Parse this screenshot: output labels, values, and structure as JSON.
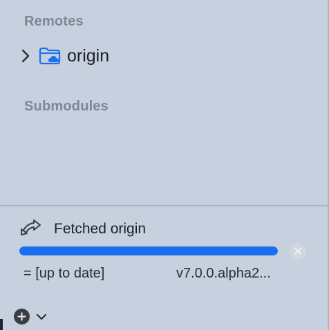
{
  "sidebar": {
    "remotes_header": "Remotes",
    "remotes": [
      {
        "label": "origin",
        "icon": "cloud-folder-icon",
        "expanded": false
      }
    ],
    "submodules_header": "Submodules"
  },
  "activity": {
    "icon": "fetch-arrow-icon",
    "title": "Fetched origin",
    "progress": 1.0,
    "log_status": "= [up to date]",
    "log_ref": "v7.0.0.alpha2..."
  },
  "footer": {
    "add_icon": "plus-circle-icon",
    "menu_icon": "chevron-down-icon"
  },
  "colors": {
    "sidebar_bg": "#c6d0de",
    "accent": "#1a6ff0",
    "header_text": "#7d8795"
  }
}
